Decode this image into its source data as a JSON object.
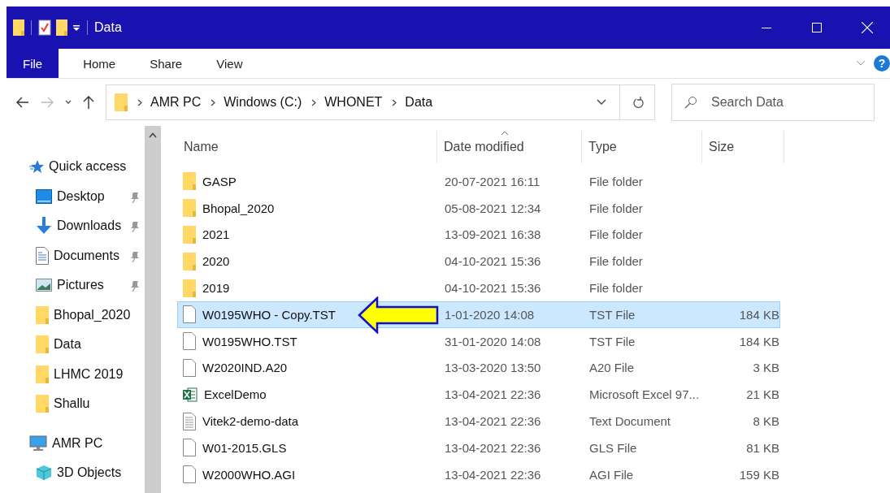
{
  "window": {
    "title": "Data"
  },
  "ribbon": {
    "tabs": [
      {
        "label": "File",
        "selected": true
      },
      {
        "label": "Home",
        "selected": false
      },
      {
        "label": "Share",
        "selected": false
      },
      {
        "label": "View",
        "selected": false
      }
    ],
    "help": "?"
  },
  "address": {
    "breadcrumbs": [
      "AMR PC",
      "Windows (C:)",
      "WHONET",
      "Data"
    ],
    "search_placeholder": "Search Data"
  },
  "sidebar": {
    "items": [
      {
        "label": "Quick access",
        "kind": "star",
        "children": [
          {
            "label": "Desktop",
            "kind": "desktop",
            "pinned": true
          },
          {
            "label": "Downloads",
            "kind": "download",
            "pinned": true
          },
          {
            "label": "Documents",
            "kind": "document",
            "pinned": true
          },
          {
            "label": "Pictures",
            "kind": "pictures",
            "pinned": true
          },
          {
            "label": "Bhopal_2020",
            "kind": "folder",
            "pinned": false
          },
          {
            "label": "Data",
            "kind": "folder",
            "pinned": false
          },
          {
            "label": "LHMC 2019",
            "kind": "folder",
            "pinned": false
          },
          {
            "label": "Shallu",
            "kind": "folder",
            "pinned": false
          }
        ]
      },
      {
        "label": "AMR PC",
        "kind": "pc",
        "children": [
          {
            "label": "3D Objects",
            "kind": "cube",
            "pinned": false
          }
        ]
      }
    ]
  },
  "table": {
    "columns": [
      {
        "label": "Name",
        "sorted": false
      },
      {
        "label": "Date modified",
        "sorted": true
      },
      {
        "label": "Type",
        "sorted": false
      },
      {
        "label": "Size",
        "sorted": false
      }
    ],
    "rows": [
      {
        "kind": "folder",
        "name": "GASP",
        "date": "20-07-2021 16:11",
        "type": "File folder",
        "size": "",
        "selected": false
      },
      {
        "kind": "folder",
        "name": "Bhopal_2020",
        "date": "05-08-2021 12:34",
        "type": "File folder",
        "size": "",
        "selected": false
      },
      {
        "kind": "folder",
        "name": "2021",
        "date": "13-09-2021 16:38",
        "type": "File folder",
        "size": "",
        "selected": false
      },
      {
        "kind": "folder",
        "name": "2020",
        "date": "04-10-2021 15:36",
        "type": "File folder",
        "size": "",
        "selected": false
      },
      {
        "kind": "folder",
        "name": "2019",
        "date": "04-10-2021 15:36",
        "type": "File folder",
        "size": "",
        "selected": false
      },
      {
        "kind": "file",
        "name": "W0195WHO - Copy.TST",
        "date": "1-01-2020 14:08",
        "type": "TST File",
        "size": "184 KB",
        "selected": true
      },
      {
        "kind": "file",
        "name": "W0195WHO.TST",
        "date": "31-01-2020 14:08",
        "type": "TST File",
        "size": "184 KB",
        "selected": false
      },
      {
        "kind": "file",
        "name": "W2020IND.A20",
        "date": "13-03-2020 13:50",
        "type": "A20 File",
        "size": "3 KB",
        "selected": false
      },
      {
        "kind": "excel",
        "name": "ExcelDemo",
        "date": "13-04-2021 22:36",
        "type": "Microsoft Excel 97...",
        "size": "21 KB",
        "selected": false
      },
      {
        "kind": "text",
        "name": "Vitek2-demo-data",
        "date": "13-04-2021 22:36",
        "type": "Text Document",
        "size": "8 KB",
        "selected": false
      },
      {
        "kind": "file",
        "name": "W01-2015.GLS",
        "date": "13-04-2021 22:36",
        "type": "GLS File",
        "size": "81 KB",
        "selected": false
      },
      {
        "kind": "file",
        "name": "W2000WHO.AGI",
        "date": "13-04-2021 22:36",
        "type": "AGI File",
        "size": "159 KB",
        "selected": false
      }
    ]
  }
}
